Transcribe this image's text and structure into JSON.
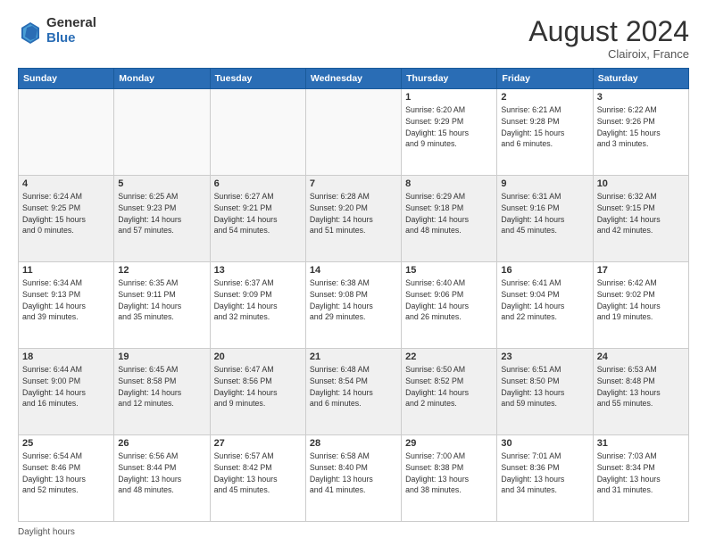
{
  "header": {
    "logo_general": "General",
    "logo_blue": "Blue",
    "month_title": "August 2024",
    "location": "Clairoix, France"
  },
  "footer": {
    "label": "Daylight hours"
  },
  "days_of_week": [
    "Sunday",
    "Monday",
    "Tuesday",
    "Wednesday",
    "Thursday",
    "Friday",
    "Saturday"
  ],
  "weeks": [
    [
      {
        "day": "",
        "info": "",
        "empty": true
      },
      {
        "day": "",
        "info": "",
        "empty": true
      },
      {
        "day": "",
        "info": "",
        "empty": true
      },
      {
        "day": "",
        "info": "",
        "empty": true
      },
      {
        "day": "1",
        "info": "Sunrise: 6:20 AM\nSunset: 9:29 PM\nDaylight: 15 hours\nand 9 minutes."
      },
      {
        "day": "2",
        "info": "Sunrise: 6:21 AM\nSunset: 9:28 PM\nDaylight: 15 hours\nand 6 minutes."
      },
      {
        "day": "3",
        "info": "Sunrise: 6:22 AM\nSunset: 9:26 PM\nDaylight: 15 hours\nand 3 minutes."
      }
    ],
    [
      {
        "day": "4",
        "info": "Sunrise: 6:24 AM\nSunset: 9:25 PM\nDaylight: 15 hours\nand 0 minutes."
      },
      {
        "day": "5",
        "info": "Sunrise: 6:25 AM\nSunset: 9:23 PM\nDaylight: 14 hours\nand 57 minutes."
      },
      {
        "day": "6",
        "info": "Sunrise: 6:27 AM\nSunset: 9:21 PM\nDaylight: 14 hours\nand 54 minutes."
      },
      {
        "day": "7",
        "info": "Sunrise: 6:28 AM\nSunset: 9:20 PM\nDaylight: 14 hours\nand 51 minutes."
      },
      {
        "day": "8",
        "info": "Sunrise: 6:29 AM\nSunset: 9:18 PM\nDaylight: 14 hours\nand 48 minutes."
      },
      {
        "day": "9",
        "info": "Sunrise: 6:31 AM\nSunset: 9:16 PM\nDaylight: 14 hours\nand 45 minutes."
      },
      {
        "day": "10",
        "info": "Sunrise: 6:32 AM\nSunset: 9:15 PM\nDaylight: 14 hours\nand 42 minutes."
      }
    ],
    [
      {
        "day": "11",
        "info": "Sunrise: 6:34 AM\nSunset: 9:13 PM\nDaylight: 14 hours\nand 39 minutes."
      },
      {
        "day": "12",
        "info": "Sunrise: 6:35 AM\nSunset: 9:11 PM\nDaylight: 14 hours\nand 35 minutes."
      },
      {
        "day": "13",
        "info": "Sunrise: 6:37 AM\nSunset: 9:09 PM\nDaylight: 14 hours\nand 32 minutes."
      },
      {
        "day": "14",
        "info": "Sunrise: 6:38 AM\nSunset: 9:08 PM\nDaylight: 14 hours\nand 29 minutes."
      },
      {
        "day": "15",
        "info": "Sunrise: 6:40 AM\nSunset: 9:06 PM\nDaylight: 14 hours\nand 26 minutes."
      },
      {
        "day": "16",
        "info": "Sunrise: 6:41 AM\nSunset: 9:04 PM\nDaylight: 14 hours\nand 22 minutes."
      },
      {
        "day": "17",
        "info": "Sunrise: 6:42 AM\nSunset: 9:02 PM\nDaylight: 14 hours\nand 19 minutes."
      }
    ],
    [
      {
        "day": "18",
        "info": "Sunrise: 6:44 AM\nSunset: 9:00 PM\nDaylight: 14 hours\nand 16 minutes."
      },
      {
        "day": "19",
        "info": "Sunrise: 6:45 AM\nSunset: 8:58 PM\nDaylight: 14 hours\nand 12 minutes."
      },
      {
        "day": "20",
        "info": "Sunrise: 6:47 AM\nSunset: 8:56 PM\nDaylight: 14 hours\nand 9 minutes."
      },
      {
        "day": "21",
        "info": "Sunrise: 6:48 AM\nSunset: 8:54 PM\nDaylight: 14 hours\nand 6 minutes."
      },
      {
        "day": "22",
        "info": "Sunrise: 6:50 AM\nSunset: 8:52 PM\nDaylight: 14 hours\nand 2 minutes."
      },
      {
        "day": "23",
        "info": "Sunrise: 6:51 AM\nSunset: 8:50 PM\nDaylight: 13 hours\nand 59 minutes."
      },
      {
        "day": "24",
        "info": "Sunrise: 6:53 AM\nSunset: 8:48 PM\nDaylight: 13 hours\nand 55 minutes."
      }
    ],
    [
      {
        "day": "25",
        "info": "Sunrise: 6:54 AM\nSunset: 8:46 PM\nDaylight: 13 hours\nand 52 minutes."
      },
      {
        "day": "26",
        "info": "Sunrise: 6:56 AM\nSunset: 8:44 PM\nDaylight: 13 hours\nand 48 minutes."
      },
      {
        "day": "27",
        "info": "Sunrise: 6:57 AM\nSunset: 8:42 PM\nDaylight: 13 hours\nand 45 minutes."
      },
      {
        "day": "28",
        "info": "Sunrise: 6:58 AM\nSunset: 8:40 PM\nDaylight: 13 hours\nand 41 minutes."
      },
      {
        "day": "29",
        "info": "Sunrise: 7:00 AM\nSunset: 8:38 PM\nDaylight: 13 hours\nand 38 minutes."
      },
      {
        "day": "30",
        "info": "Sunrise: 7:01 AM\nSunset: 8:36 PM\nDaylight: 13 hours\nand 34 minutes."
      },
      {
        "day": "31",
        "info": "Sunrise: 7:03 AM\nSunset: 8:34 PM\nDaylight: 13 hours\nand 31 minutes."
      }
    ]
  ]
}
